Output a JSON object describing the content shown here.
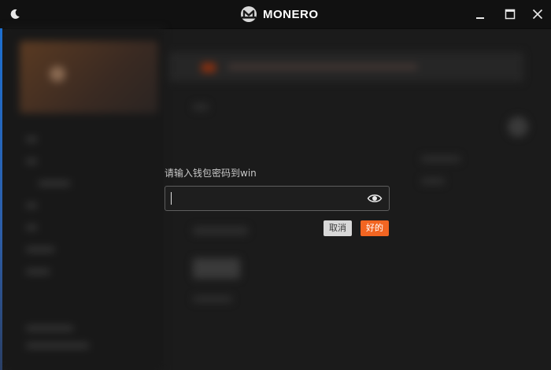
{
  "app": {
    "title": "MONERO"
  },
  "icons": {
    "theme": "moon-icon",
    "logo": "monero-logo-icon",
    "minimize": "minimize-icon",
    "maximize": "maximize-icon",
    "close": "close-icon",
    "show_password": "eye-icon"
  },
  "dialog": {
    "prompt": "请输入钱包密码到win",
    "password_value": "",
    "cancel_label": "取消",
    "ok_label": "好的"
  },
  "colors": {
    "accent": "#f26522",
    "titlebar": "#111111",
    "background": "#1b1b1b"
  }
}
